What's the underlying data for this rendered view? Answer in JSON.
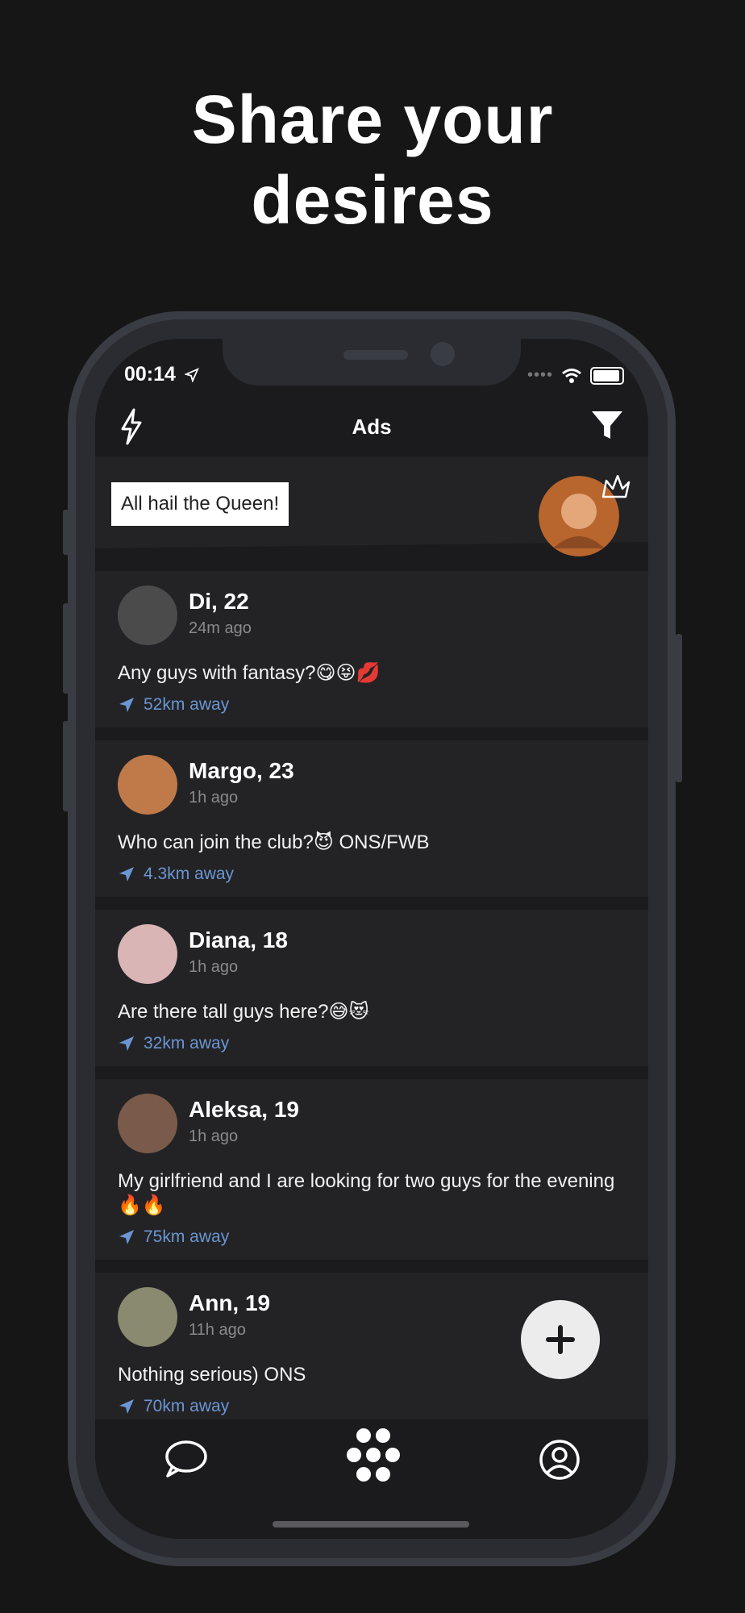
{
  "headline": {
    "line1": "Share your",
    "line2": "desires"
  },
  "status": {
    "time": "00:14",
    "dots": "••••"
  },
  "nav": {
    "title": "Ads",
    "left_icon": "lightning-icon",
    "right_icon": "filter-icon"
  },
  "banner": {
    "text": "All hail the Queen!"
  },
  "cards": [
    {
      "name": "Di, 22",
      "ago": "24m ago",
      "message": "Any guys with fantasy?😋😝💋",
      "distance": "52km away",
      "avatar_color": "#555"
    },
    {
      "name": "Margo, 23",
      "ago": "1h ago",
      "message": "Who can join the club?😈 ONS/FWB",
      "distance": "4.3km away",
      "avatar_color": "#c07a4a"
    },
    {
      "name": "Diana, 18",
      "ago": "1h ago",
      "message": "Are there tall guys here?😅😻",
      "distance": "32km away",
      "avatar_color": "#d9b5b5"
    },
    {
      "name": "Aleksa, 19",
      "ago": "1h ago",
      "message": "My girlfriend and I are looking for two guys for the evening🔥🔥",
      "distance": "75km away",
      "avatar_color": "#7a5a4a"
    },
    {
      "name": "Ann, 19",
      "ago": "11h ago",
      "message": "Nothing serious) ONS",
      "distance": "70km away",
      "avatar_color": "#8a8a70"
    }
  ],
  "colors": {
    "accent_distance": "#6a96d4",
    "card_bg": "#232325",
    "background": "#161616"
  },
  "tabbar": {
    "items": [
      "chat-icon",
      "dots-cluster-icon",
      "profile-icon"
    ]
  }
}
